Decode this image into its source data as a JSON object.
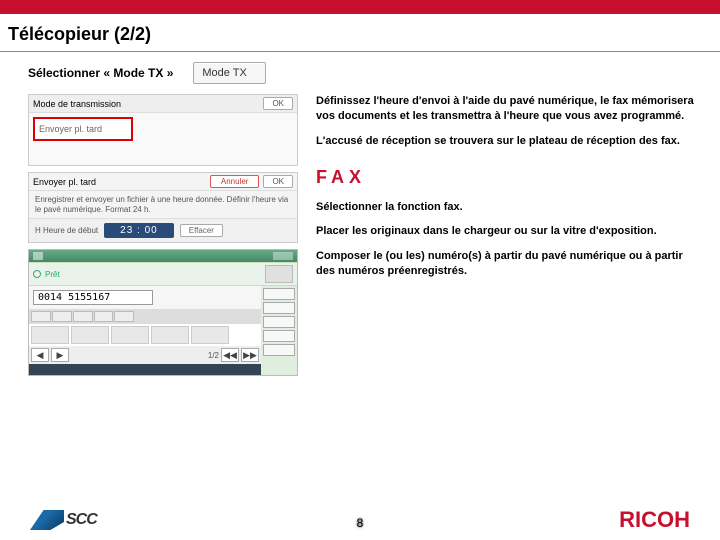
{
  "header": {
    "title": "Télécopieur (2/2)"
  },
  "step1": {
    "label": "Sélectionner « Mode TX »",
    "button": "Mode TX"
  },
  "panel_mode": {
    "head": "Mode de transmission",
    "ok": "OK",
    "boxed": "Envoyer pl. tard"
  },
  "panel_time": {
    "head": "Envoyer pl. tard",
    "cancel": "Annuler",
    "ok": "OK",
    "desc": "Enregistrer et envoyer un fichier à une heure donnée. Définir l'heure via le pavé numérique. Format 24 h.",
    "startlabel": "H Heure de début",
    "time": "23 : 00",
    "clear": "Effacer"
  },
  "right_texts": {
    "p1": "Définissez l'heure d'envoi à l'aide du pavé numérique, le fax mémorisera vos documents et les transmettra à l'heure que vous avez programmé.",
    "p2": "L'accusé de réception se trouvera sur le plateau de réception des fax."
  },
  "fax": {
    "title": "FAX",
    "p1": "Sélectionner la fonction fax.",
    "p2": "Placer les originaux dans le chargeur ou sur la vitre d'exposition.",
    "p3": "Composer le (ou les) numéro(s) à partir du pavé numérique ou à partir des numéros préenregistrés."
  },
  "faxpanel": {
    "pret": "Prêt",
    "number": "0014 5155167",
    "arrows": [
      "◀",
      "▶",
      "◀◀",
      "▶▶"
    ],
    "side": "1/2"
  },
  "footer": {
    "scc": "SCC",
    "page": "8",
    "ricoh": "RICOH"
  }
}
